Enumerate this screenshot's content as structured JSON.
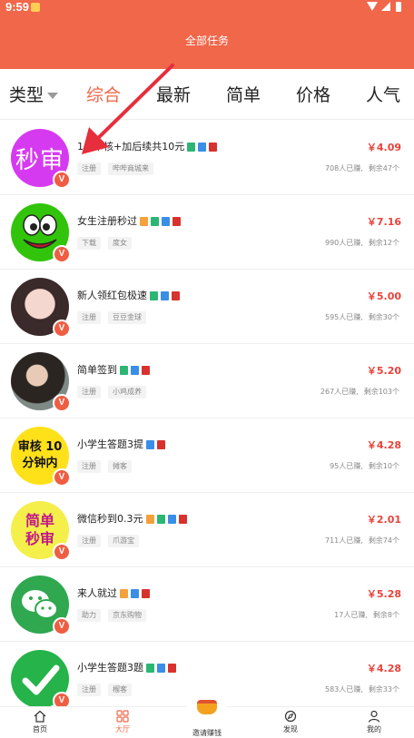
{
  "status_bar": {
    "time": "9:59"
  },
  "header": {
    "title": "全部任务"
  },
  "tabs": [
    {
      "label": "类型"
    },
    {
      "label": "综合"
    },
    {
      "label": "最新"
    },
    {
      "label": "简单"
    },
    {
      "label": "价格"
    },
    {
      "label": "人气"
    }
  ],
  "tasks": [
    {
      "title": "1分审核+加后续共10元",
      "price": "￥4.09",
      "chip1": "注册",
      "chip2": "哔哔商城来",
      "done": "708人已赚,",
      "left": "剩余47个",
      "avatar_text": "秒审",
      "tags": [
        "green",
        "blue",
        "red"
      ]
    },
    {
      "title": "女生注册秒过",
      "price": "￥7.16",
      "chip1": "下载",
      "chip2": "度女",
      "done": "990人已赚,",
      "left": "剩余12个",
      "avatar_text": "",
      "tags": [
        "green",
        "blue",
        "red"
      ]
    },
    {
      "title": "新人领红包极速",
      "price": "￥5.00",
      "chip1": "注册",
      "chip2": "豆豆金球",
      "done": "595人已赚,",
      "left": "剩余30个",
      "avatar_text": "",
      "tags": [
        "green",
        "blue",
        "red"
      ]
    },
    {
      "title": "简单签到",
      "price": "￥5.20",
      "chip1": "注册",
      "chip2": "小鸡成养",
      "done": "267人已赚,",
      "left": "剩余103个",
      "avatar_text": "",
      "tags": [
        "green",
        "blue",
        "red"
      ]
    },
    {
      "title": "小学生答题3提",
      "price": "￥4.28",
      "chip1": "注册",
      "chip2": "摊客",
      "done": "95人已赚,",
      "left": "剩余10个",
      "avatar_text": "审核 10分钟内",
      "tags": [
        "blue",
        "red"
      ]
    },
    {
      "title": "微信秒到0.3元",
      "price": "￥2.01",
      "chip1": "注册",
      "chip2": "爪游宝",
      "done": "711人已赚,",
      "left": "剩余74个",
      "avatar_text": "简单 秒审",
      "tags": [
        "green",
        "blue",
        "red"
      ]
    },
    {
      "title": "来人就过",
      "price": "￥5.28",
      "chip1": "助力",
      "chip2": "京东购物",
      "done": "17人已赚,",
      "left": "剩余8个",
      "avatar_text": "",
      "tags": [
        "blue",
        "red"
      ]
    },
    {
      "title": "小学生答题3题",
      "price": "￥4.28",
      "chip1": "注册",
      "chip2": "榴客",
      "done": "583人已赚,",
      "left": "剩余33个",
      "avatar_text": "",
      "tags": [
        "green",
        "blue",
        "red"
      ]
    }
  ],
  "badge_letter": "V",
  "bottom_nav": [
    {
      "label": "首页"
    },
    {
      "label": "大厅"
    },
    {
      "label": "邀请赚钱"
    },
    {
      "label": "发现"
    },
    {
      "label": "我的"
    }
  ],
  "colors": {
    "accent": "#f0674a",
    "price": "#e8433a"
  }
}
